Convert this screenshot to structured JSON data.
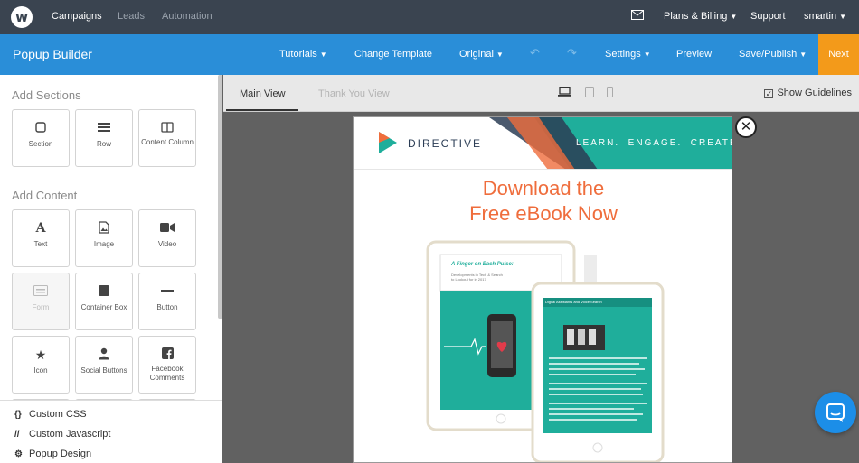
{
  "topnav": {
    "logo": "w",
    "campaigns": "Campaigns",
    "leads": "Leads",
    "automation": "Automation",
    "plans": "Plans & Billing",
    "support": "Support",
    "user": "smartin"
  },
  "builder": {
    "title": "Popup Builder",
    "tutorials": "Tutorials",
    "change_template": "Change Template",
    "original": "Original",
    "settings": "Settings",
    "preview": "Preview",
    "save_publish": "Save/Publish",
    "next": "Next"
  },
  "sidebar": {
    "add_sections": "Add Sections",
    "sections": [
      {
        "label": "Section",
        "icon": "square-icon"
      },
      {
        "label": "Row",
        "icon": "rows-icon"
      },
      {
        "label": "Content Column",
        "icon": "column-icon"
      }
    ],
    "add_content": "Add Content",
    "content": [
      {
        "label": "Text",
        "icon": "text-icon"
      },
      {
        "label": "Image",
        "icon": "image-icon"
      },
      {
        "label": "Video",
        "icon": "video-icon"
      },
      {
        "label": "Form",
        "icon": "form-icon"
      },
      {
        "label": "Container Box",
        "icon": "container-icon"
      },
      {
        "label": "Button",
        "icon": "button-icon"
      },
      {
        "label": "Icon",
        "icon": "star-icon"
      },
      {
        "label": "Social Buttons",
        "icon": "user-icon"
      },
      {
        "label": "Facebook Comments",
        "icon": "facebook-icon"
      }
    ],
    "custom_css": "Custom CSS",
    "custom_js": "Custom Javascript",
    "popup_design": "Popup Design"
  },
  "viewbar": {
    "main_view": "Main View",
    "thank_you": "Thank You View",
    "show_guidelines": "Show Guidelines"
  },
  "popup": {
    "brand": "DIRECTIVE",
    "tagline": "LEARN.  ENGAGE.  CREATE.",
    "headline1": "Download the",
    "headline2": "Free eBook Now",
    "tablet1_title": "A Finger on Each Pulse:",
    "tablet1_sub": "Developments in Tech & Search\nto Lookout for in 2017",
    "tablet2_title": "Digital Assistants and Voice Search"
  },
  "colors": {
    "nav_bg": "#3a4450",
    "builder_blue": "#2a8ed8",
    "next_orange": "#f39a1a",
    "headline_orange": "#ef6d3c",
    "teal": "#1fae9b"
  }
}
